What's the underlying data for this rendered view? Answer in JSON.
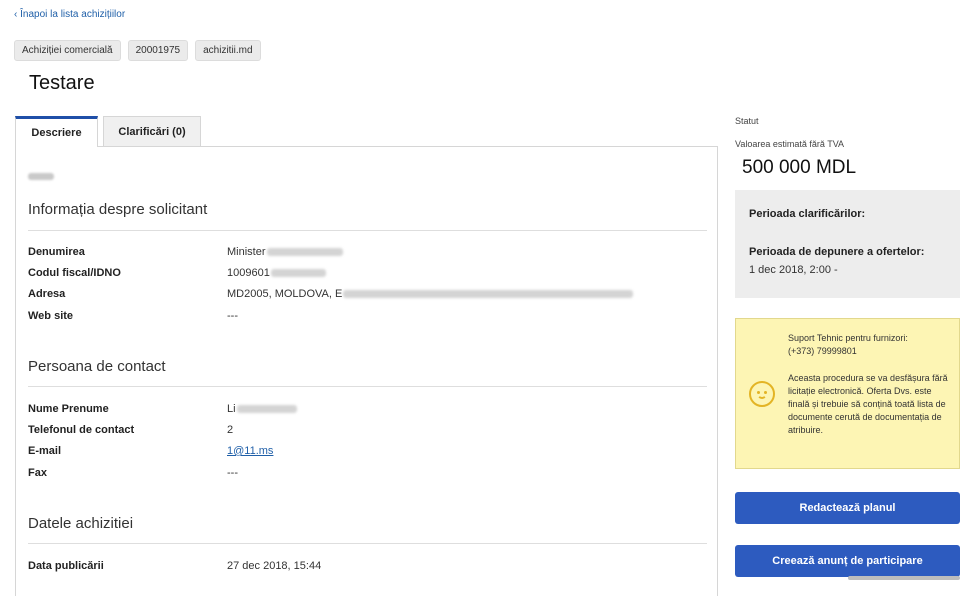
{
  "nav": {
    "back_label": "‹ Înapoi la lista achizițiilor"
  },
  "chips": [
    "Achiziției comercială",
    "20001975",
    "achizitii.md"
  ],
  "page": {
    "title": "Testare"
  },
  "tabs": [
    {
      "label": "Descriere",
      "active": true
    },
    {
      "label": "Clarificări (0)",
      "active": false
    }
  ],
  "requester": {
    "title": "Informația despre solicitant",
    "fields": [
      {
        "label": "Denumirea",
        "value": "Minister"
      },
      {
        "label": "Codul fiscal/IDNO",
        "value": "1009601"
      },
      {
        "label": "Adresa",
        "value": "MD2005, MOLDOVA, E"
      },
      {
        "label": "Web site",
        "value": "---"
      }
    ]
  },
  "contact": {
    "title": "Persoana de contact",
    "fields": [
      {
        "label": "Nume Prenume",
        "value": "Li"
      },
      {
        "label": "Telefonul de contact",
        "value": "2"
      },
      {
        "label": "E-mail",
        "value": "1@11.ms"
      },
      {
        "label": "Fax",
        "value": "---"
      }
    ]
  },
  "procurement": {
    "title": "Datele achizitiei",
    "fields": [
      {
        "label": "Data publicării",
        "value": "27 dec 2018, 15:44"
      }
    ]
  },
  "sidebar": {
    "status_label": "Statut",
    "estimated_label": "Valoarea estimată fără TVA",
    "estimated_value": "500 000 MDL",
    "clarification_period_label": "Perioada clarificărilor:",
    "offers_period_label": "Perioada de depunere a ofertelor:",
    "offers_period_value": "1 dec 2018, 2:00 -",
    "support_line1": "Suport Tehnic pentru furnizori:",
    "support_phone": "(+373) 79999801",
    "support_notice": "Aceasta procedura se va desfășura fără licitație electronică. Oferta Dvs. este finală și trebuie să conțină toată lista de documente cerută de documentația de atribuire.",
    "edit_plan_button": "Redactează planul",
    "create_notice_button": "Creează anunț de participare"
  },
  "colors": {
    "primary": "#2d5bbf",
    "link": "#1f5fa8",
    "notice_bg": "#fdf5b4",
    "panel_bg": "#ededed"
  }
}
